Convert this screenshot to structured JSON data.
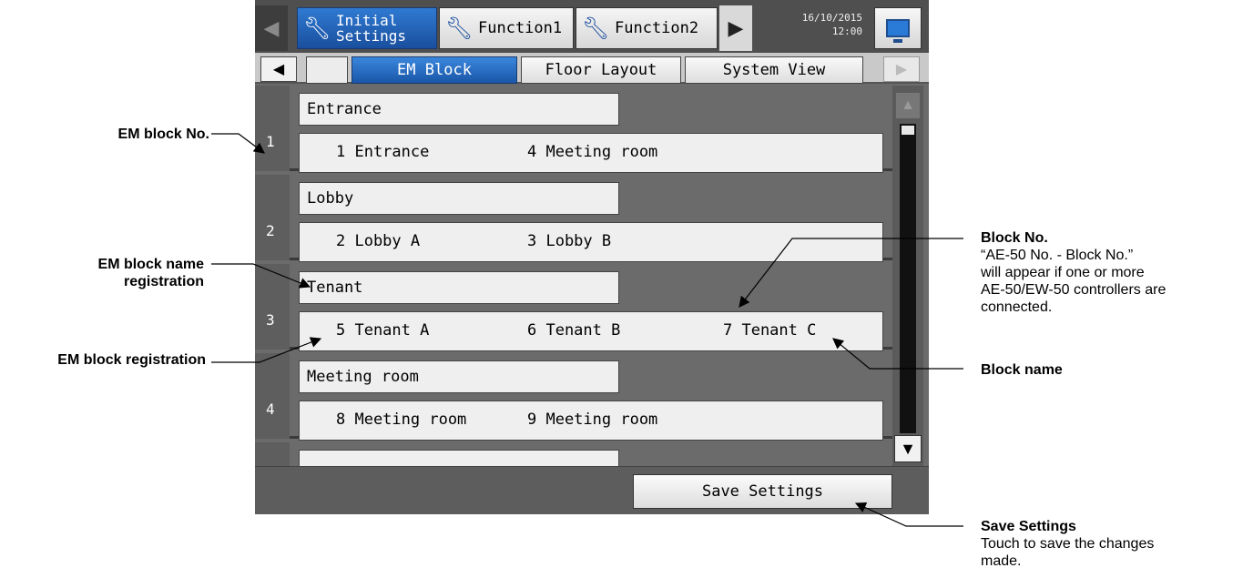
{
  "header": {
    "tabs": [
      {
        "label_line1": "Initial",
        "label_line2": "Settings",
        "icon": "wrench-icon",
        "active": true
      },
      {
        "label": "Function1",
        "icon": "wrench-icon",
        "active": false
      },
      {
        "label": "Function2",
        "icon": "wrench-icon",
        "active": false
      }
    ],
    "date": "16/10/2015",
    "time": "12:00"
  },
  "subtabs": [
    {
      "label": "EM Block",
      "active": true
    },
    {
      "label": "Floor Layout",
      "active": false
    },
    {
      "label": "System View",
      "active": false
    }
  ],
  "rows": [
    {
      "number": "1",
      "name": "Entrance",
      "blocks": [
        "1 Entrance",
        "4 Meeting room"
      ]
    },
    {
      "number": "2",
      "name": "Lobby",
      "blocks": [
        "2 Lobby A",
        "3 Lobby B"
      ]
    },
    {
      "number": "3",
      "name": "Tenant",
      "blocks": [
        "5 Tenant A",
        "6 Tenant B",
        "7 Tenant C"
      ]
    },
    {
      "number": "4",
      "name": "Meeting room",
      "blocks": [
        "8 Meeting room",
        "9 Meeting room"
      ]
    }
  ],
  "footer": {
    "save_label": "Save Settings"
  },
  "annotations": {
    "em_block_no": "EM block No.",
    "em_block_name_line1": "EM block name",
    "em_block_name_line2": "registration",
    "em_block_registration": "EM block registration",
    "block_no_title": "Block No.",
    "block_no_line1": "“AE-50 No. - Block No.”",
    "block_no_line2": "will appear if one or more",
    "block_no_line3": "AE-50/EW-50 controllers are",
    "block_no_line4": "connected.",
    "block_name": "Block name",
    "save_title": "Save Settings",
    "save_line1": "Touch to save the changes",
    "save_line2": "made."
  },
  "colors": {
    "active_tab": "#1a56a8",
    "panel": "#6b6b6b"
  }
}
